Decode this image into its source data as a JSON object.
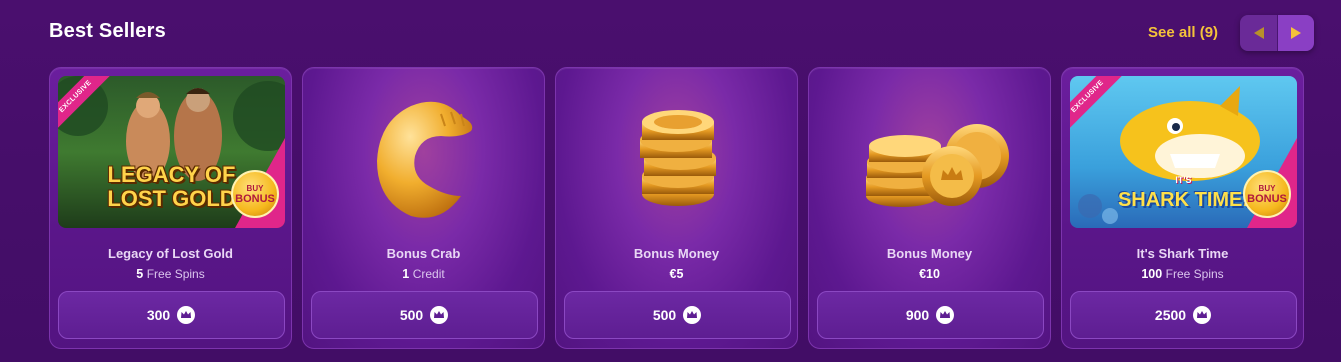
{
  "section": {
    "title": "Best Sellers",
    "see_all": "See all (9)"
  },
  "colors": {
    "accent": "#f4c23a",
    "card_bg": "#5a1689",
    "ribbon": "#e0268a"
  },
  "cards": [
    {
      "name": "Legacy of Lost Gold",
      "amount": "5",
      "unit": "Free Spins",
      "price": "300",
      "ribbon": "EXCLUSIVE",
      "art_title_1": "LEGACY OF",
      "art_title_2": "LOST GOLD",
      "badge_top": "BUY",
      "badge_bottom": "BONUS"
    },
    {
      "name": "Bonus Crab",
      "amount": "1",
      "unit": "Credit",
      "price": "500"
    },
    {
      "name": "Bonus Money",
      "amount": "€5",
      "unit": "",
      "price": "500"
    },
    {
      "name": "Bonus Money",
      "amount": "€10",
      "unit": "",
      "price": "900"
    },
    {
      "name": "It's Shark Time",
      "amount": "100",
      "unit": "Free Spins",
      "price": "2500",
      "ribbon": "EXCLUSIVE",
      "art_title_1": "IT'S",
      "art_title_2": "SHARK TIME!",
      "badge_top": "BUY",
      "badge_bottom": "BONUS"
    }
  ],
  "icons": {
    "currency": "crown-icon",
    "prev": "chevron-left-icon",
    "next": "chevron-right-icon"
  }
}
